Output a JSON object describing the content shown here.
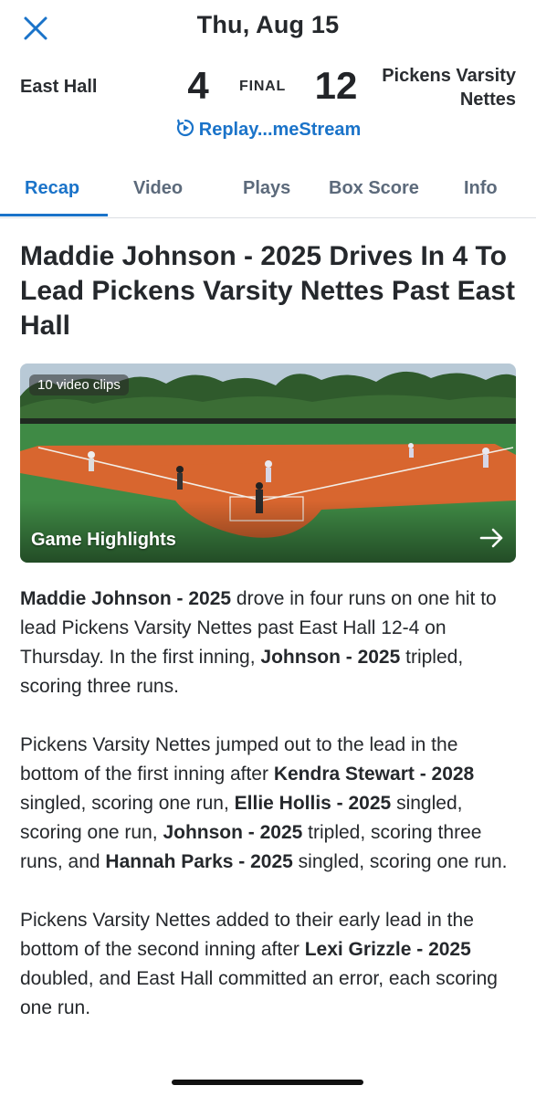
{
  "header": {
    "close_icon": "close-icon",
    "date": "Thu, Aug 15"
  },
  "score": {
    "away_team": "East Hall",
    "away_score": "4",
    "status": "FINAL",
    "home_score": "12",
    "home_team": "Pickens Varsity Nettes",
    "replay_label": "Replay...meStream",
    "replay_icon": "replay-play-icon"
  },
  "tabs": [
    {
      "label": "Recap",
      "active": true
    },
    {
      "label": "Video",
      "active": false
    },
    {
      "label": "Plays",
      "active": false
    },
    {
      "label": "Box Score",
      "active": false
    },
    {
      "label": "Info",
      "active": false
    }
  ],
  "article": {
    "headline": "Maddie Johnson - 2025 Drives In 4 To Lead Pickens Varsity Nettes Past East Hall",
    "video": {
      "clips_badge": "10 video clips",
      "label": "Game Highlights",
      "arrow_icon": "arrow-right-icon"
    },
    "paragraphs": [
      [
        {
          "text": "Maddie Johnson - 2025",
          "bold": true
        },
        {
          "text": " drove in four runs on one hit to lead Pickens Varsity Nettes past East Hall 12-4 on Thursday. In the first inning, ",
          "bold": false
        },
        {
          "text": "Johnson - 2025",
          "bold": true
        },
        {
          "text": " tripled, scoring three runs.",
          "bold": false
        }
      ],
      [
        {
          "text": "Pickens Varsity Nettes jumped out to the lead in the bottom of the first inning after ",
          "bold": false
        },
        {
          "text": "Kendra Stewart - 2028",
          "bold": true
        },
        {
          "text": " singled, scoring one run, ",
          "bold": false
        },
        {
          "text": "Ellie Hollis - 2025",
          "bold": true
        },
        {
          "text": " singled, scoring one run, ",
          "bold": false
        },
        {
          "text": "Johnson - 2025",
          "bold": true
        },
        {
          "text": " tripled, scoring three runs, and ",
          "bold": false
        },
        {
          "text": "Hannah Parks - 2025",
          "bold": true
        },
        {
          "text": " singled, scoring one run.",
          "bold": false
        }
      ],
      [
        {
          "text": "Pickens Varsity Nettes added to their early lead in the bottom of the second inning after ",
          "bold": false
        },
        {
          "text": "Lexi Grizzle - 2025",
          "bold": true
        },
        {
          "text": " doubled, and East Hall committed an error, each scoring one run.",
          "bold": false
        }
      ]
    ]
  },
  "colors": {
    "accent": "#1a73c9",
    "tab_inactive": "#5c6a7b",
    "text": "#25282c"
  }
}
